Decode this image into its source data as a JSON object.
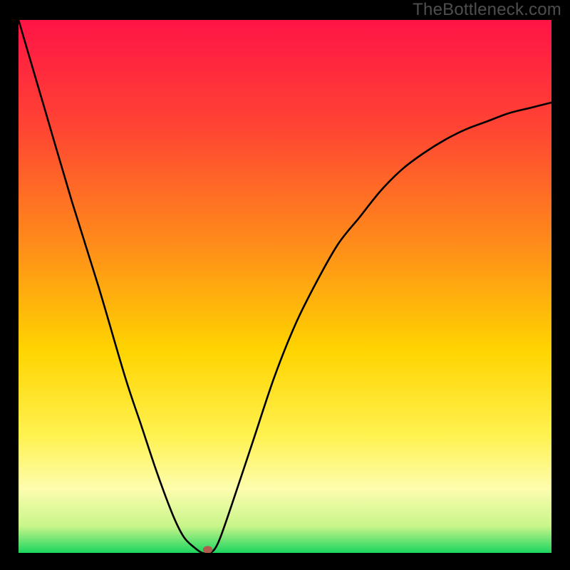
{
  "watermark": "TheBottleneck.com",
  "colors": {
    "frame": "#000000",
    "gradient_stops": [
      {
        "offset": 0.0,
        "color": "#ff1446"
      },
      {
        "offset": 0.2,
        "color": "#ff4433"
      },
      {
        "offset": 0.42,
        "color": "#ff8c1a"
      },
      {
        "offset": 0.62,
        "color": "#ffd400"
      },
      {
        "offset": 0.78,
        "color": "#fff250"
      },
      {
        "offset": 0.88,
        "color": "#fdfdae"
      },
      {
        "offset": 0.95,
        "color": "#c8f58a"
      },
      {
        "offset": 1.0,
        "color": "#1bd65f"
      }
    ],
    "curve": "#000000",
    "marker": "#b25b4f"
  },
  "chart_data": {
    "type": "line",
    "title": "",
    "xlabel": "",
    "ylabel": "",
    "xlim": [
      0,
      100
    ],
    "ylim": [
      0,
      100
    ],
    "grid": false,
    "legend": false,
    "annotation": "TheBottleneck.com",
    "series": [
      {
        "name": "bottleneck-curve",
        "x": [
          0,
          5,
          10,
          15,
          20,
          23,
          26,
          29,
          31,
          33,
          34.5,
          36,
          37.5,
          40,
          44,
          48,
          52,
          56,
          60,
          64,
          68,
          72,
          76,
          80,
          84,
          88,
          92,
          96,
          100
        ],
        "y": [
          100,
          83,
          66,
          50,
          33,
          24,
          15,
          7,
          3,
          1,
          0,
          0,
          2,
          9,
          21,
          33,
          43,
          51,
          58,
          63,
          68,
          72,
          75,
          77.5,
          79.5,
          81,
          82.5,
          83.5,
          84.5
        ]
      }
    ],
    "markers": [
      {
        "name": "optimum-marker",
        "x": 35.5,
        "y": 0.6
      }
    ]
  }
}
